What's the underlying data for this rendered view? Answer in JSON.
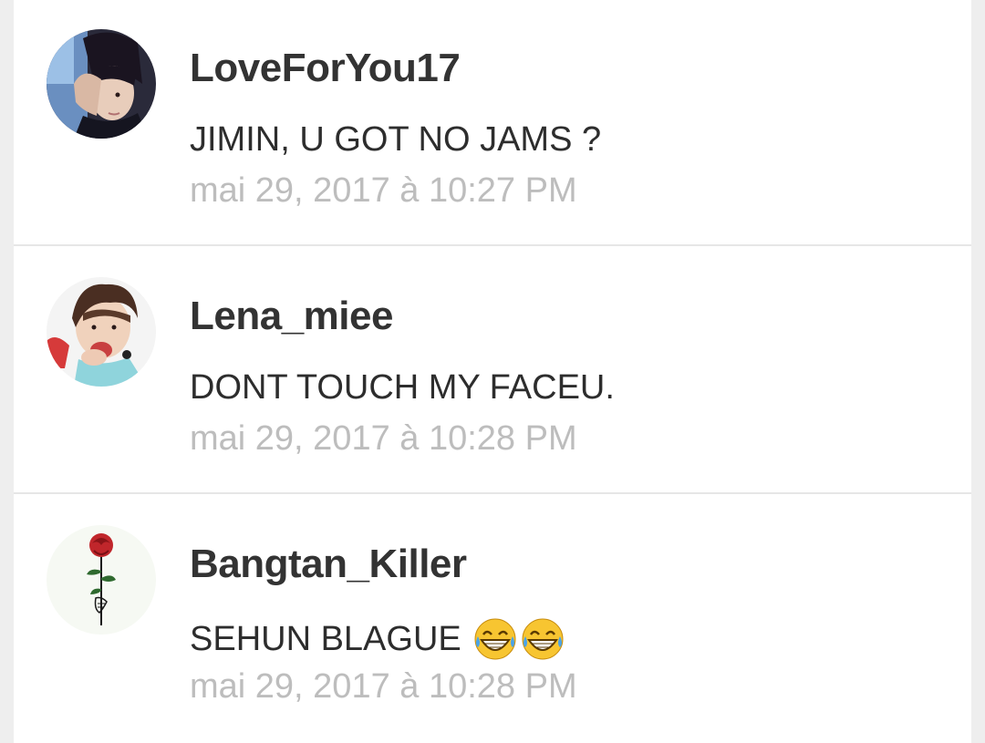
{
  "comments": [
    {
      "username": "LoveForYou17",
      "message": "JIMIN, U GOT NO JAMS ?",
      "timestamp": "mai 29, 2017 à 10:27 PM",
      "avatar_icon": "user-photo-avatar"
    },
    {
      "username": "Lena_miee",
      "message": "DONT TOUCH MY FACEU.",
      "timestamp": "mai 29, 2017 à 10:28 PM",
      "avatar_icon": "user-photo-avatar"
    },
    {
      "username": "Bangtan_Killer",
      "message": "SEHUN BLAGUE",
      "emoji": [
        "face-with-tears-of-joy-icon",
        "face-with-tears-of-joy-icon"
      ],
      "timestamp": "mai 29, 2017 à 10:28 PM",
      "avatar_icon": "rose-avatar"
    }
  ],
  "colors": {
    "background": "#eeeeee",
    "card": "#ffffff",
    "username": "#333333",
    "message": "#2d2d2d",
    "timestamp": "#bdbdbd",
    "divider": "#e6e6e6"
  }
}
